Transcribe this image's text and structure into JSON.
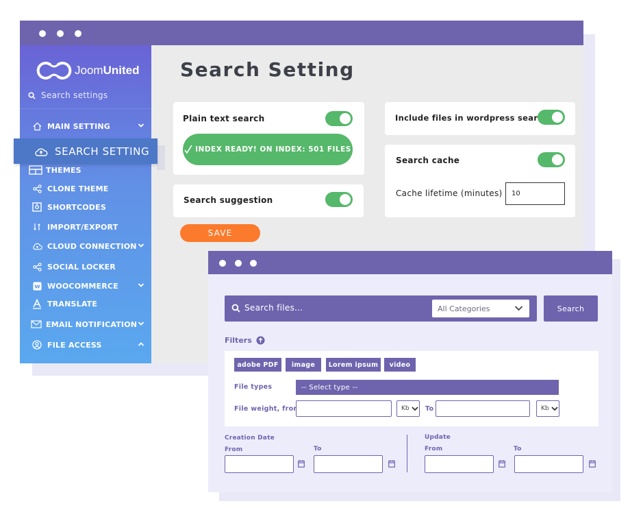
{
  "settings_window": {
    "brand": {
      "name_light": "Joom",
      "name_bold": "United"
    },
    "sidebar": {
      "search_placeholder": "Search settings",
      "items": [
        {
          "label": "MAIN SETTING",
          "icon": "home-icon",
          "expandable": true,
          "expanded": false
        },
        {
          "label": "SEARCH SETTING",
          "icon": "cloud-upload-icon",
          "active": true
        },
        {
          "label": "THEMES",
          "icon": "layout-icon"
        },
        {
          "label": "CLONE THEME",
          "icon": "share-icon"
        },
        {
          "label": "SHORTCODES",
          "icon": "shortcode-icon"
        },
        {
          "label": "IMPORT/EXPORT",
          "icon": "arrows-icon"
        },
        {
          "label": "CLOUD CONNECTION",
          "icon": "cloud-icon",
          "expandable": true,
          "expanded": false
        },
        {
          "label": "SOCIAL LOCKER",
          "icon": "share-icon"
        },
        {
          "label": "WOOCOMMERCE",
          "icon": "woocommerce-icon",
          "expandable": true,
          "expanded": false
        },
        {
          "label": "TRANSLATE",
          "icon": "translate-icon"
        },
        {
          "label": "EMAIL NOTIFICATION",
          "icon": "mail-icon",
          "expandable": true,
          "expanded": false
        },
        {
          "label": "FILE ACCESS",
          "icon": "user-circle-icon",
          "expandable": true,
          "expanded": true
        }
      ]
    },
    "page_title": "Search Setting",
    "options": {
      "plain_text_search": {
        "label": "Plain text search",
        "enabled": true
      },
      "index_status": "INDEX READY! ON INDEX: 501 FILES",
      "search_suggestion": {
        "label": "Search suggestion",
        "enabled": true
      },
      "include_files_wp": {
        "label": "Include files in wordpress search",
        "enabled": true
      },
      "search_cache": {
        "label": "Search cache",
        "enabled": true
      },
      "cache_lifetime": {
        "label": "Cache lifetime (minutes)",
        "value": "10"
      }
    },
    "save_label": "SAVE"
  },
  "search_window": {
    "search_placeholder": "Search files...",
    "category_selected": "All Categories",
    "search_button": "Search",
    "filters_label": "Filters",
    "tags": [
      "adobe PDF",
      "image",
      "Lorem ipsum",
      "video"
    ],
    "file_types_label": "File types",
    "file_types_placeholder": "-- Select type --",
    "file_weight_label": "File weight, from",
    "unit_from": "Kb",
    "to_label": "To",
    "unit_to": "Kb",
    "creation_date": {
      "label": "Creation Date",
      "from": "From",
      "to": "To"
    },
    "update_date": {
      "label": "Update",
      "from": "From",
      "to": "To"
    }
  },
  "colors": {
    "titlebar": "#6e64ad",
    "toggle_on": "#56b86a",
    "save": "#fb7a2c",
    "sidebar_top": "#6a63d6",
    "sidebar_bottom": "#5aa8ef"
  }
}
